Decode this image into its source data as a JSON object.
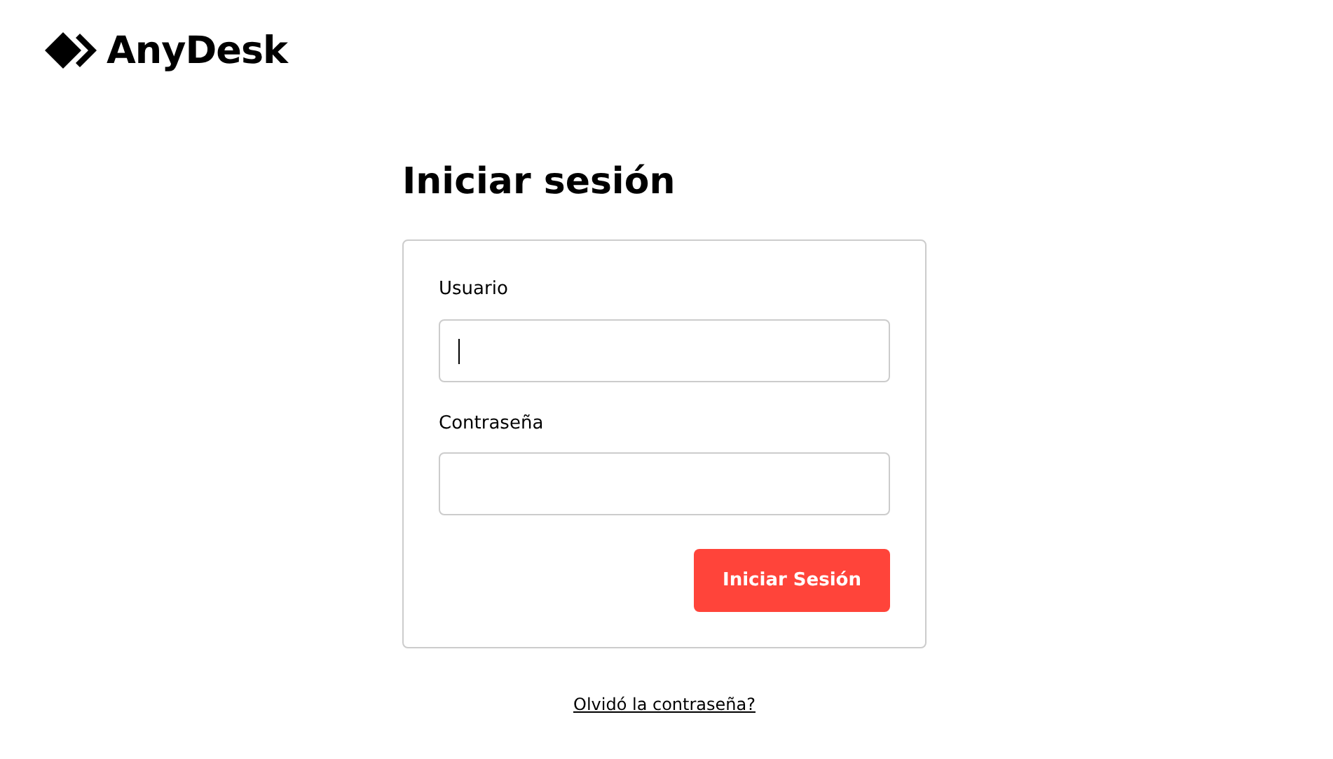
{
  "logo": {
    "text": "AnyDesk"
  },
  "title": "Iniciar sesión",
  "fields": [
    {
      "label": "Usuario",
      "focused": true
    },
    {
      "label": "Contraseña",
      "focused": false
    }
  ],
  "submit_button": "Iniciar Sesión",
  "forgot_link": "Olvidó la contraseña?"
}
